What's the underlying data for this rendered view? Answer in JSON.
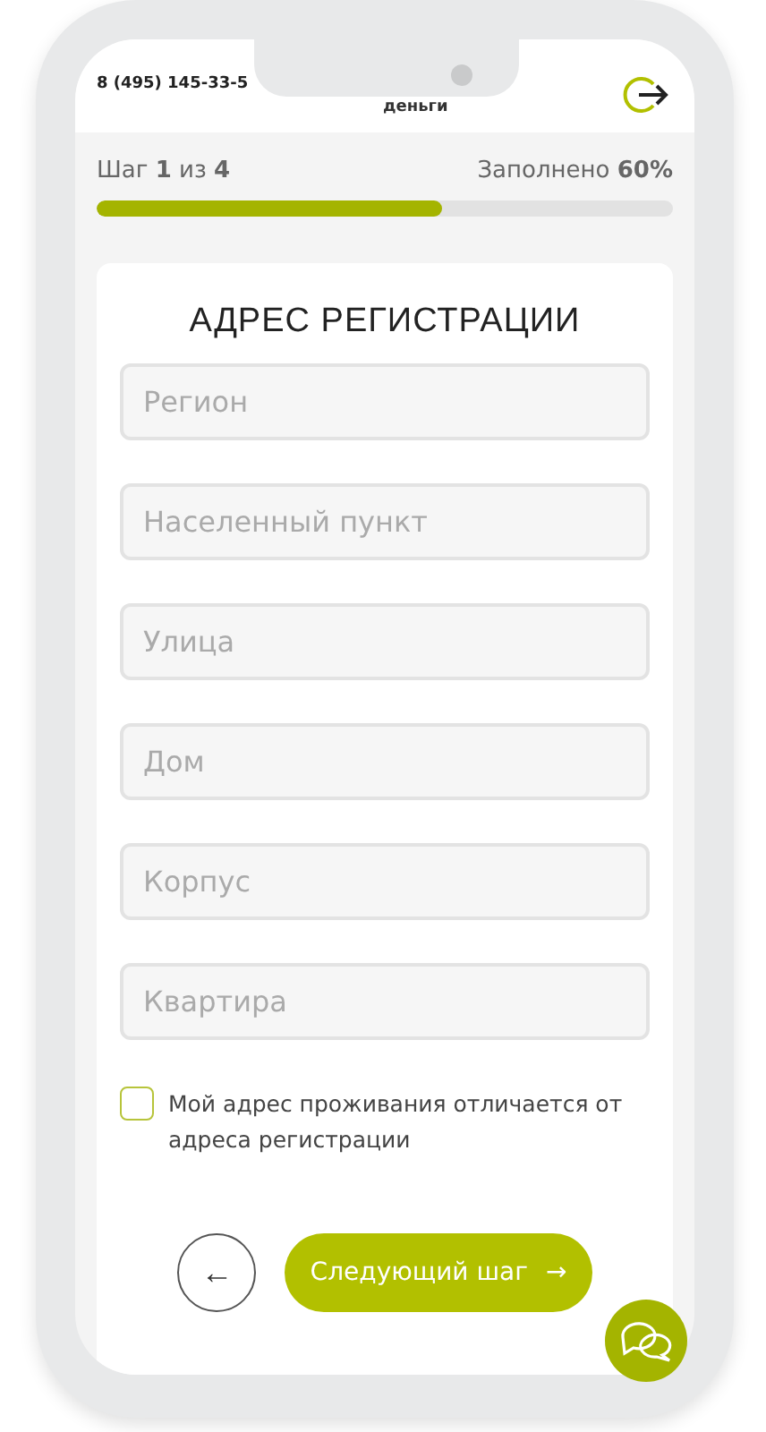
{
  "header": {
    "phone": "8 (495) 145-33-5",
    "brand": "деньги"
  },
  "progress": {
    "step": "Шаг **1** из **4**",
    "filled": "Заполнено **60%**",
    "level": 0.6
  },
  "form": {
    "title": "АДРЕС РЕГИСТРАЦИИ",
    "fields": [
      {
        "placeholder": "Регион"
      },
      {
        "placeholder": "Населенный пункт"
      },
      {
        "placeholder": "Улица"
      },
      {
        "placeholder": "Дом"
      },
      {
        "placeholder": "Корпус"
      },
      {
        "placeholder": "Квартира"
      }
    ],
    "checkbox": {
      "label": "Мой адрес проживания отличается от адреса регистрации",
      "checked": false
    },
    "back_button": "←",
    "next_button": {
      "label": "Следующий шаг",
      "arrow": "→"
    }
  }
}
